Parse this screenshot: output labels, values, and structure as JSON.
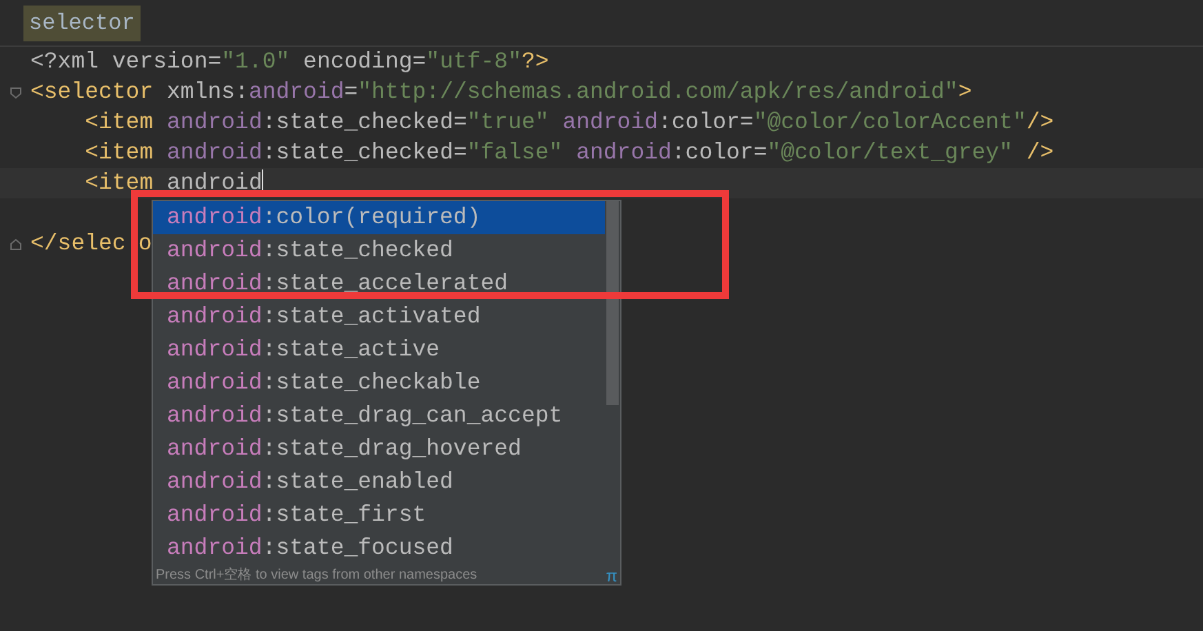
{
  "breadcrumb": {
    "label": "selector"
  },
  "code_lines": [
    {
      "kind": "plain",
      "tokens": [
        {
          "kind": "plain",
          "text": "<?xml version="
        },
        {
          "kind": "value",
          "text": "\"1.0\""
        },
        {
          "kind": "plain",
          "text": " encoding="
        },
        {
          "kind": "value",
          "text": "\"utf-8\""
        },
        {
          "kind": "tag",
          "text": "?>"
        }
      ]
    },
    {
      "kind": "fold_start",
      "tokens": [
        {
          "kind": "tag",
          "text": "<selector"
        },
        {
          "kind": "attr",
          "text": " xmlns:"
        },
        {
          "kind": "ns",
          "text": "android"
        },
        {
          "kind": "attr",
          "text": "="
        },
        {
          "kind": "value",
          "text": "\"http://schemas.android.com/apk/res/android\""
        },
        {
          "kind": "tag",
          "text": ">"
        }
      ]
    },
    {
      "kind": "plain",
      "tokens": [
        {
          "kind": "tag",
          "text": "    <item "
        },
        {
          "kind": "ns",
          "text": "android"
        },
        {
          "kind": "attr",
          "text": ":state_checked="
        },
        {
          "kind": "value",
          "text": "\"true\" "
        },
        {
          "kind": "ns",
          "text": "android"
        },
        {
          "kind": "attr",
          "text": ":color="
        },
        {
          "kind": "value",
          "text": "\"@color/colorAccent\""
        },
        {
          "kind": "tag",
          "text": "/>"
        }
      ]
    },
    {
      "kind": "plain",
      "tokens": [
        {
          "kind": "tag",
          "text": "    <item "
        },
        {
          "kind": "ns",
          "text": "android"
        },
        {
          "kind": "attr",
          "text": ":state_checked="
        },
        {
          "kind": "value",
          "text": "\"false\" "
        },
        {
          "kind": "ns",
          "text": "android"
        },
        {
          "kind": "attr",
          "text": ":color="
        },
        {
          "kind": "value",
          "text": "\"@color/text_grey\" "
        },
        {
          "kind": "tag",
          "text": "/>"
        }
      ]
    },
    {
      "current": true,
      "kind": "plain",
      "tokens": [
        {
          "kind": "tag",
          "text": "    <item "
        },
        {
          "kind": "attr",
          "text": "android"
        }
      ]
    },
    {
      "kind": "plain"
    },
    {
      "kind": "fold_end",
      "tokens": [
        {
          "kind": "tag",
          "text": "</selec"
        },
        {
          "kind": "tag_after_gap",
          "text": "o"
        }
      ]
    }
  ],
  "completion_popup": {
    "items": [
      {
        "namespace": "android",
        "name": ":color(required)",
        "selected": true
      },
      {
        "namespace": "android",
        "name": ":state_checked",
        "selected": false
      },
      {
        "namespace": "android",
        "name": ":state_accelerated",
        "selected": false
      },
      {
        "namespace": "android",
        "name": ":state_activated",
        "selected": false
      },
      {
        "namespace": "android",
        "name": ":state_active",
        "selected": false
      },
      {
        "namespace": "android",
        "name": ":state_checkable",
        "selected": false
      },
      {
        "namespace": "android",
        "name": ":state_drag_can_accept",
        "selected": false
      },
      {
        "namespace": "android",
        "name": ":state_drag_hovered",
        "selected": false
      },
      {
        "namespace": "android",
        "name": ":state_enabled",
        "selected": false
      },
      {
        "namespace": "android",
        "name": ":state_first",
        "selected": false
      },
      {
        "namespace": "android",
        "name": ":state_focused",
        "selected": false
      }
    ],
    "footer": "Press Ctrl+空格 to view tags from other namespaces",
    "footer_icon": "π"
  }
}
